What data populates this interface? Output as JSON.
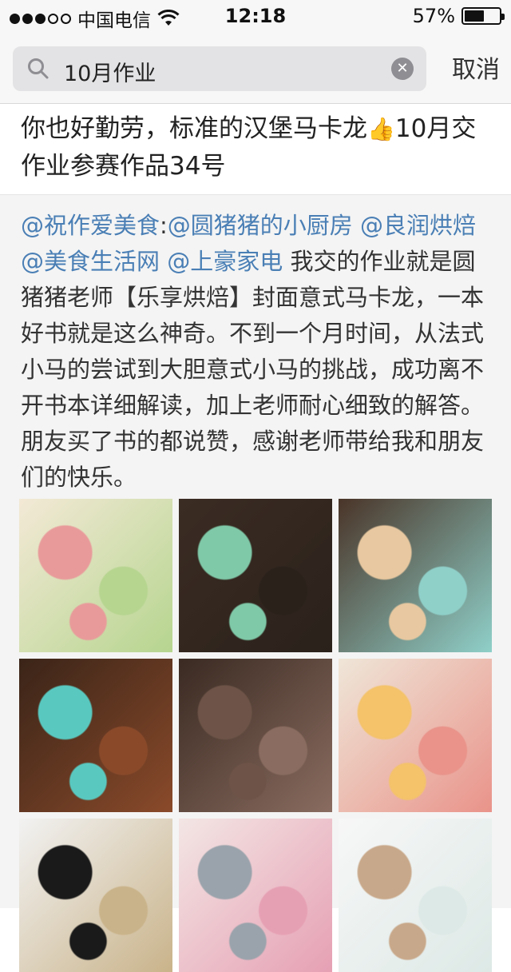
{
  "status_bar": {
    "carrier": "中国电信",
    "time": "12:18",
    "battery": "57%",
    "battery_level": 0.57,
    "signal_bars": 3,
    "signal_total": 5
  },
  "search": {
    "query": "10月作业",
    "cancel_label": "取消"
  },
  "post": {
    "title": "你也好勤劳，标准的汉堡马卡龙👍10月交作业参赛作品34号",
    "title_before_emoji": "你也好勤劳，标准的汉堡马卡龙",
    "title_emoji": "👍",
    "title_after_emoji": "10月交作业参赛作品34号",
    "mentions": [
      "@祝作爱美食",
      ":",
      "@圆猪猪的小厨房",
      " ",
      "@良润烘焙",
      " ",
      "@美食生活网",
      " ",
      "@上豪家电"
    ],
    "body": " 我交的作业就是圆猪猪老师【乐享烘焙】封面意式马卡龙，一本好书就是这么神奇。不到一个月时间，从法式小马的尝试到大胆意式小马的挑战，成功离不开书本详细解读，加上老师耐心细致的解答。朋友买了书的都说赞，感谢老师带给我和朋友们的快乐。"
  },
  "photos": [
    {
      "name": "photo-book-cover",
      "colors": [
        "#f3e9d6",
        "#e89a9a",
        "#b6d58f"
      ]
    },
    {
      "name": "photo-green-macarons-tray",
      "colors": [
        "#3b2c23",
        "#7fc9a8",
        "#2a211b"
      ]
    },
    {
      "name": "photo-scattered-macarons",
      "colors": [
        "#4a3428",
        "#e8c8a0",
        "#8fd0c9"
      ]
    },
    {
      "name": "photo-blue-macarons-wood",
      "colors": [
        "#3a2418",
        "#59c9c0",
        "#8a4a2a"
      ]
    },
    {
      "name": "photo-chocolate-shells",
      "colors": [
        "#3a2a22",
        "#6e5448",
        "#8a6c60"
      ]
    },
    {
      "name": "photo-book-page-macarons",
      "colors": [
        "#efe6d8",
        "#f4c36a",
        "#e9938a"
      ]
    },
    {
      "name": "photo-bread-flour-logo",
      "colors": [
        "#f2f2f2",
        "#1a1a1a",
        "#c9b38a"
      ]
    },
    {
      "name": "photo-stand-mixer-ad",
      "colors": [
        "#f3e6e4",
        "#9aa3ab",
        "#e6a0b4"
      ]
    },
    {
      "name": "photo-collage-thumbnails",
      "colors": [
        "#f7f7f7",
        "#c8a88a",
        "#dde9e6"
      ]
    }
  ]
}
